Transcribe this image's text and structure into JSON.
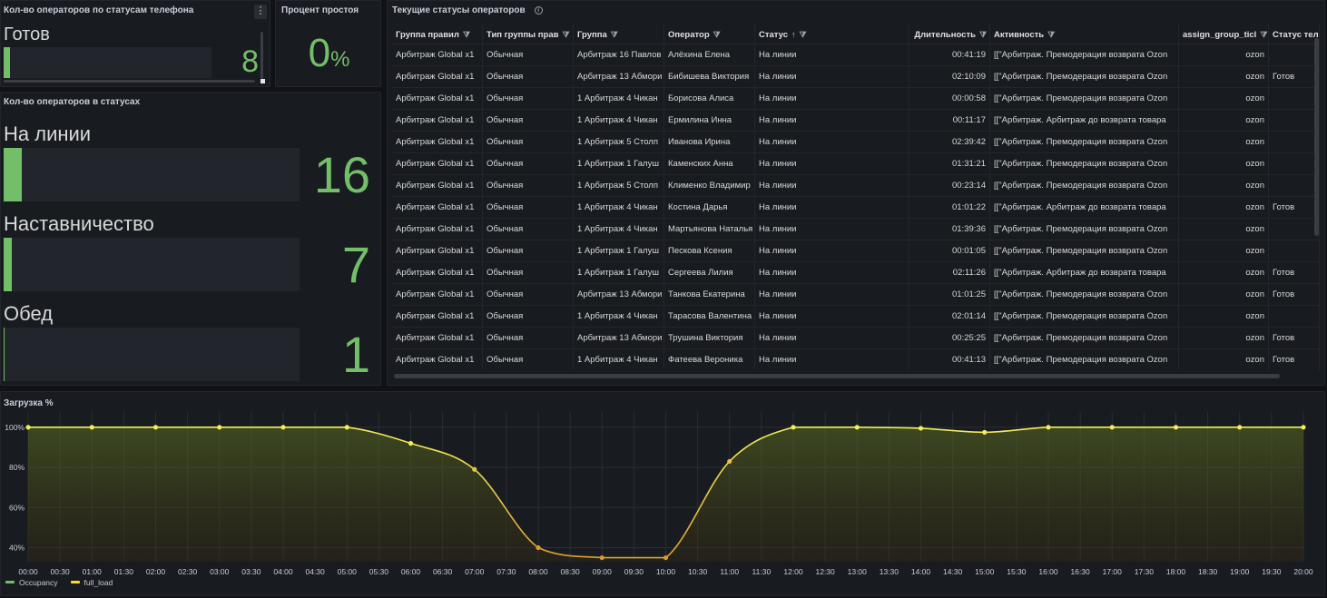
{
  "colors": {
    "accent_green": "#73bf69",
    "line_yellow": "#fade2a",
    "bg": "#111217",
    "panel": "#181b1f"
  },
  "phone_panel": {
    "title": "Кол-во операторов по статусам телефона",
    "menu_icon": "⋮",
    "label": "Готов",
    "value": "8",
    "fill": 0.03
  },
  "idle_panel": {
    "title": "Процент простоя",
    "value": "0",
    "unit": "%"
  },
  "status_panel": {
    "title": "Кол-во операторов в статусах",
    "items": [
      {
        "label": "На линии",
        "value": "16",
        "fill": 0.06
      },
      {
        "label": "Наставничество",
        "value": "7",
        "fill": 0.028
      },
      {
        "label": "Обед",
        "value": "1",
        "fill": 0.004
      }
    ]
  },
  "table_panel": {
    "title": "Текущие статусы операторов",
    "info_icon": "i",
    "filter_icon": "⧩",
    "sort_icon": "↑",
    "columns": [
      "Группа правил",
      "Тип группы прав",
      "Группа",
      "Оператор",
      "Статус",
      "Длительность",
      "Активность",
      "assign_group_ticl",
      "Статус теле"
    ],
    "rows": [
      [
        "Арбитраж Global x1",
        "Обычная",
        "Арбитраж 16 Павлов",
        "Алёхина Елена",
        "На линии",
        "00:41:19",
        "[[\"Арбитраж. Премодерация возврата Ozon",
        "ozon",
        ""
      ],
      [
        "Арбитраж Global x1",
        "Обычная",
        "Арбитраж 13 Абмори",
        "Бибишева Виктория",
        "На линии",
        "02:10:09",
        "[[\"Арбитраж. Премодерация возврата Ozon",
        "ozon",
        "Готов"
      ],
      [
        "Арбитраж Global x1",
        "Обычная",
        "1 Арбитраж 4 Чикан",
        "Борисова Алиса",
        "На линии",
        "00:00:58",
        "[[\"Арбитраж. Премодерация возврата Ozon",
        "ozon",
        ""
      ],
      [
        "Арбитраж Global x1",
        "Обычная",
        "1 Арбитраж 4 Чикан",
        "Ермилина Инна",
        "На линии",
        "00:11:17",
        "[[\"Арбитраж. Арбитраж до возврата товара",
        "ozon",
        ""
      ],
      [
        "Арбитраж Global x1",
        "Обычная",
        "1 Арбитраж 5 Столп",
        "Иванова Ирина",
        "На линии",
        "02:39:42",
        "[[\"Арбитраж. Премодерация возврата Ozon",
        "ozon",
        ""
      ],
      [
        "Арбитраж Global x1",
        "Обычная",
        "1 Арбитраж 1 Галуш",
        "Каменских Анна",
        "На линии",
        "01:31:21",
        "[[\"Арбитраж. Премодерация возврата Ozon",
        "ozon",
        ""
      ],
      [
        "Арбитраж Global x1",
        "Обычная",
        "1 Арбитраж 5 Столп",
        "Клименко Владимир",
        "На линии",
        "00:23:14",
        "[[\"Арбитраж. Премодерация возврата Ozon",
        "ozon",
        ""
      ],
      [
        "Арбитраж Global x1",
        "Обычная",
        "1 Арбитраж 4 Чикан",
        "Костина Дарья",
        "На линии",
        "01:01:22",
        "[[\"Арбитраж. Арбитраж до возврата товара",
        "ozon",
        "Готов"
      ],
      [
        "Арбитраж Global x1",
        "Обычная",
        "1 Арбитраж 4 Чикан",
        "Мартьянова Наталья",
        "На линии",
        "01:39:36",
        "[[\"Арбитраж. Премодерация возврата Ozon",
        "ozon",
        ""
      ],
      [
        "Арбитраж Global x1",
        "Обычная",
        "1 Арбитраж 1 Галуш",
        "Пескова Ксения",
        "На линии",
        "00:01:05",
        "[[\"Арбитраж. Премодерация возврата Ozon",
        "ozon",
        ""
      ],
      [
        "Арбитраж Global x1",
        "Обычная",
        "1 Арбитраж 1 Галуш",
        "Сергеева Лилия",
        "На линии",
        "02:11:26",
        "[[\"Арбитраж. Арбитраж до возврата товара",
        "ozon",
        "Готов"
      ],
      [
        "Арбитраж Global x1",
        "Обычная",
        "Арбитраж 13 Абмори",
        "Танкова Екатерина",
        "На линии",
        "01:01:25",
        "[[\"Арбитраж. Премодерация возврата Ozon",
        "ozon",
        "Готов"
      ],
      [
        "Арбитраж Global x1",
        "Обычная",
        "1 Арбитраж 4 Чикан",
        "Тарасова Валентина",
        "На линии",
        "02:01:14",
        "[[\"Арбитраж. Премодерация возврата Ozon",
        "ozon",
        ""
      ],
      [
        "Арбитраж Global x1",
        "Обычная",
        "Арбитраж 13 Абмори",
        "Трушина Виктория",
        "На линии",
        "00:25:25",
        "[[\"Арбитраж. Премодерация возврата Ozon",
        "ozon",
        "Готов"
      ],
      [
        "Арбитраж Global x1",
        "Обычная",
        "1 Арбитраж 4 Чикан",
        "Фатеева Вероника",
        "На линии",
        "00:41:13",
        "[[\"Арбитраж. Премодерация возврата Ozon",
        "ozon",
        "Готов"
      ]
    ]
  },
  "load_panel": {
    "title": "Загрузка %"
  },
  "chart_data": {
    "type": "line",
    "title": "Загрузка %",
    "x": [
      "00:00",
      "00:30",
      "01:00",
      "01:30",
      "02:00",
      "02:30",
      "03:00",
      "03:30",
      "04:00",
      "04:30",
      "05:00",
      "05:30",
      "06:00",
      "06:30",
      "07:00",
      "07:30",
      "08:00",
      "08:30",
      "09:00",
      "09:30",
      "10:00",
      "10:30",
      "11:00",
      "11:30",
      "12:00",
      "12:30",
      "13:00",
      "13:30",
      "14:00",
      "14:30",
      "15:00",
      "15:30",
      "16:00",
      "16:30",
      "17:00",
      "17:30",
      "18:00",
      "18:30",
      "19:00",
      "19:30",
      "20:00"
    ],
    "y_ticks": [
      "100%",
      "80%",
      "60%",
      "40%"
    ],
    "ylim": [
      33,
      104
    ],
    "grid": true,
    "legend_position": "bottom-left",
    "series": [
      {
        "name": "Occupancy",
        "color": "#73bf69",
        "points": []
      },
      {
        "name": "full_load",
        "color": "#fade2a",
        "points": [
          [
            "00:00",
            100
          ],
          [
            "01:00",
            100
          ],
          [
            "02:00",
            100
          ],
          [
            "03:00",
            100
          ],
          [
            "04:00",
            100
          ],
          [
            "05:00",
            100
          ],
          [
            "06:00",
            92
          ],
          [
            "07:00",
            79
          ],
          [
            "08:00",
            40
          ],
          [
            "09:00",
            35
          ],
          [
            "10:00",
            35
          ],
          [
            "11:00",
            83
          ],
          [
            "12:00",
            100
          ],
          [
            "13:00",
            100
          ],
          [
            "14:00",
            99.5
          ],
          [
            "15:00",
            97.5
          ],
          [
            "16:00",
            100
          ],
          [
            "17:00",
            100
          ],
          [
            "18:00",
            100
          ],
          [
            "19:00",
            100
          ],
          [
            "20:00",
            100
          ]
        ]
      }
    ]
  }
}
